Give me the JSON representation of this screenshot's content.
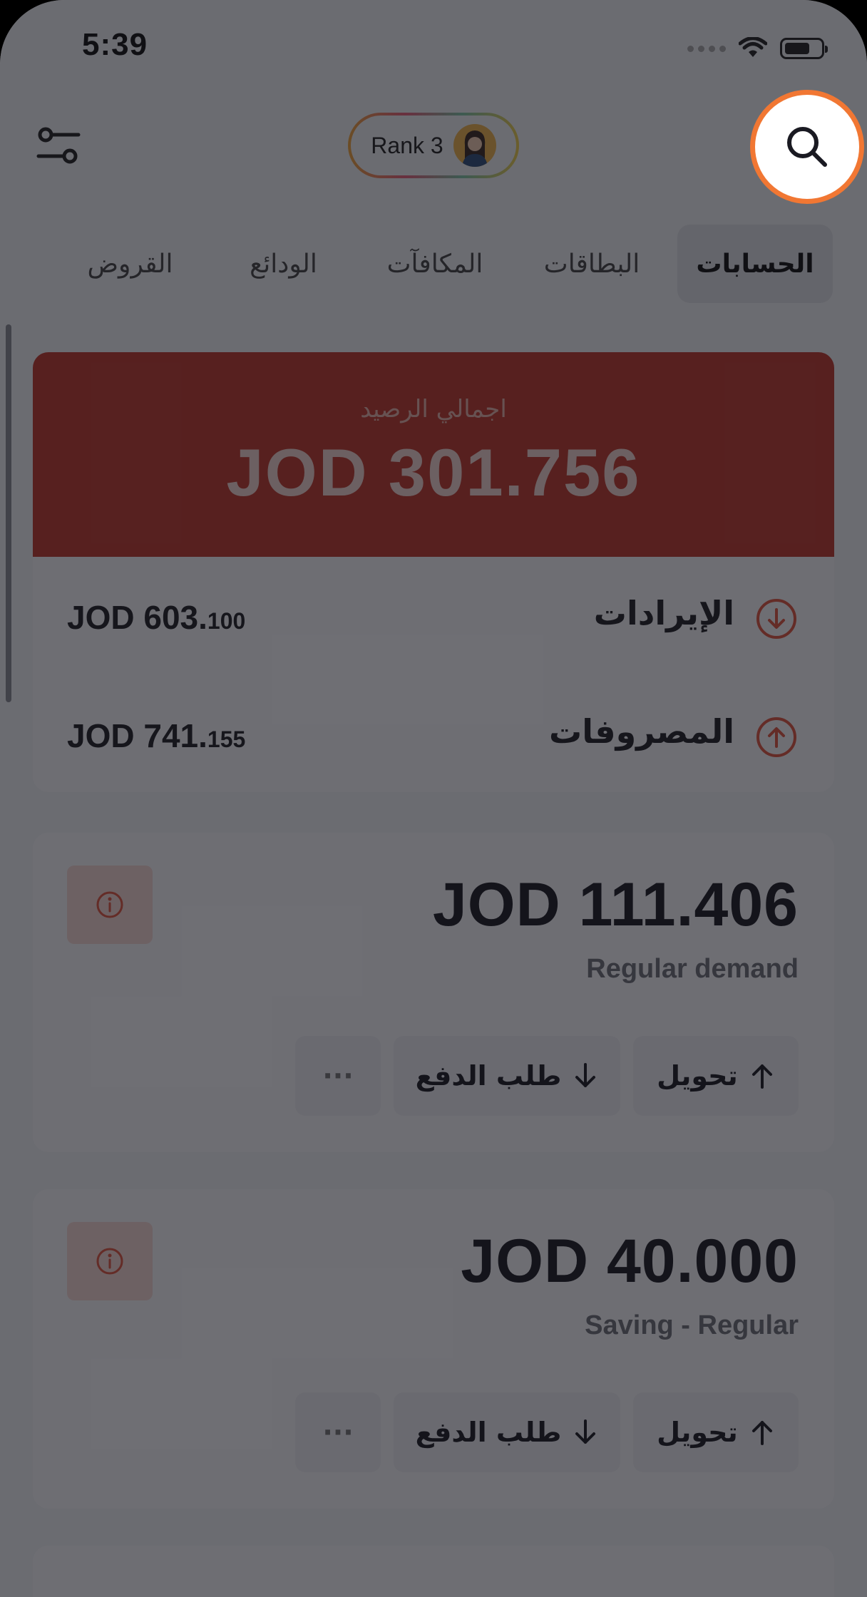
{
  "status_bar": {
    "time": "5:39"
  },
  "header": {
    "rank_label": "Rank 3",
    "filter_icon": "sliders-icon",
    "search_icon": "search-icon"
  },
  "tabs": [
    {
      "label": "الحسابات",
      "active": true
    },
    {
      "label": "البطاقات",
      "active": false
    },
    {
      "label": "المكافآت",
      "active": false
    },
    {
      "label": "الودائع",
      "active": false
    },
    {
      "label": "القروض",
      "active": false
    }
  ],
  "balance": {
    "label": "اجمالي الرصيد",
    "value": "JOD 301.756"
  },
  "summary": {
    "income": {
      "label": "الإيرادات",
      "amount_main": "JOD 603.",
      "amount_fraction": "100"
    },
    "expenses": {
      "label": "المصروفات",
      "amount_main": "JOD 741.",
      "amount_fraction": "155"
    }
  },
  "accounts": [
    {
      "amount": "JOD 111.406",
      "type": "Regular demand",
      "transfer_label": "تحويل",
      "request_label": "طلب الدفع",
      "more_label": "···"
    },
    {
      "amount": "JOD 40.000",
      "type": "Saving - Regular",
      "transfer_label": "تحويل",
      "request_label": "طلب الدفع",
      "more_label": "···"
    }
  ],
  "colors": {
    "brand_red": "#c0392b",
    "highlight_orange": "#f17733"
  }
}
